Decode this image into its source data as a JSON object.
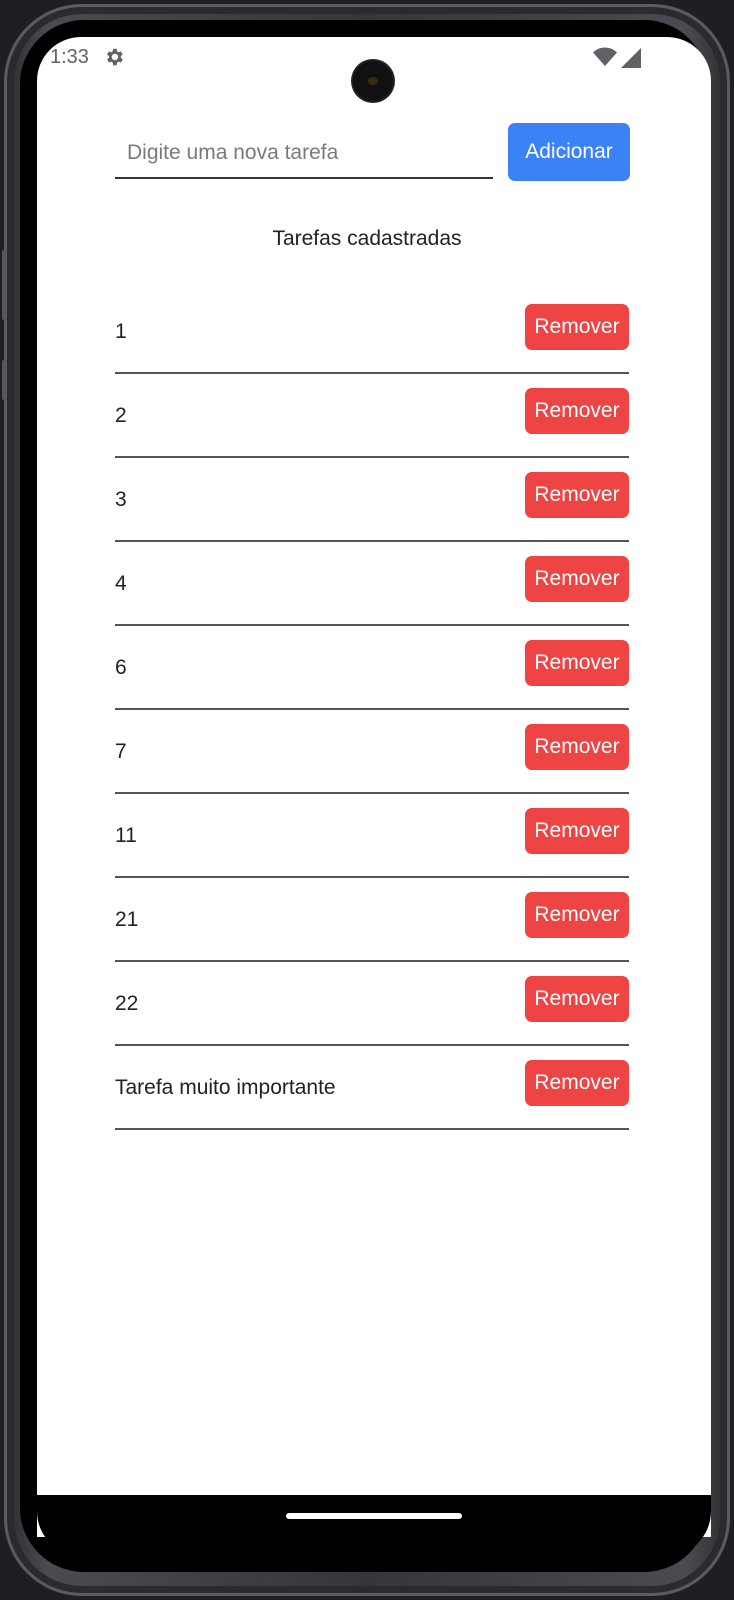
{
  "status_bar": {
    "time": "1:33",
    "icons": [
      "gear-icon",
      "wifi-icon",
      "signal-icon"
    ]
  },
  "form": {
    "input_placeholder": "Digite uma nova tarefa",
    "input_value": "",
    "add_label": "Adicionar"
  },
  "list": {
    "title": "Tarefas cadastradas",
    "remove_label": "Remover",
    "items": [
      {
        "label": "1"
      },
      {
        "label": "2"
      },
      {
        "label": "3"
      },
      {
        "label": "4"
      },
      {
        "label": "6"
      },
      {
        "label": "7"
      },
      {
        "label": "11"
      },
      {
        "label": "21"
      },
      {
        "label": "22"
      },
      {
        "label": "Tarefa muito importante"
      }
    ]
  },
  "colors": {
    "add_button": "#3b82f6",
    "remove_button": "#ef4444",
    "background": "#ffffff"
  }
}
